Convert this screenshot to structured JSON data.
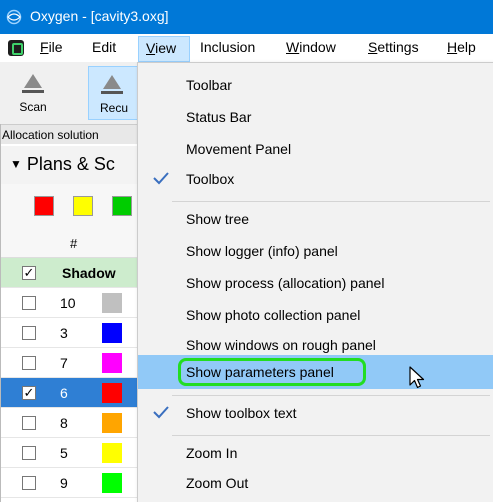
{
  "window": {
    "title": "Oxygen - [cavity3.oxg]"
  },
  "menubar": {
    "items": [
      {
        "label": "File",
        "u": "F",
        "rest": "ile"
      },
      {
        "label": "Edit"
      },
      {
        "label": "View",
        "u": "V",
        "rest": "iew"
      },
      {
        "label": "Inclusion"
      },
      {
        "label": "Window",
        "u": "W",
        "rest": "indow"
      },
      {
        "label": "Settings",
        "u": "S",
        "rest": "ettings"
      },
      {
        "label": "Help",
        "u": "H",
        "rest": "elp"
      }
    ]
  },
  "toolbar": {
    "scan_label": "Scan",
    "recu_label": "Recu"
  },
  "panel": {
    "allocation_label": "Allocation solution",
    "plans_label": "Plans & Sc",
    "column_hash": "#",
    "shadow_label": "Shadow",
    "rows": [
      {
        "num": "10",
        "color": "#c0c0c0",
        "checked": false
      },
      {
        "num": "3",
        "color": "#0000ff",
        "checked": false
      },
      {
        "num": "7",
        "color": "#ff00ff",
        "checked": false
      },
      {
        "num": "6",
        "color": "#ff0000",
        "checked": true
      },
      {
        "num": "8",
        "color": "#ffa500",
        "checked": false
      },
      {
        "num": "5",
        "color": "#ffff00",
        "checked": false
      },
      {
        "num": "9",
        "color": "#00ff00",
        "checked": false
      }
    ],
    "swatch_colors": [
      "#ff0000",
      "#ffff00",
      "#00cc00"
    ]
  },
  "view_menu": {
    "items": [
      {
        "label": "Toolbar",
        "checked": false
      },
      {
        "label": "Status Bar",
        "checked": false
      },
      {
        "label": "Movement Panel",
        "checked": false
      },
      {
        "label": "Toolbox",
        "checked": true
      },
      {
        "label": "Show tree",
        "checked": false
      },
      {
        "label": "Show logger (info) panel",
        "checked": false
      },
      {
        "label": "Show process (allocation) panel",
        "checked": false
      },
      {
        "label": "Show photo collection panel",
        "checked": false
      },
      {
        "label": "Show windows on rough panel",
        "checked": false
      },
      {
        "label": "Show parameters panel",
        "checked": false,
        "highlighted": true
      },
      {
        "label": "Show toolbox text",
        "checked": true
      },
      {
        "label": "Zoom In",
        "checked": false
      },
      {
        "label": "Zoom Out",
        "checked": false
      }
    ]
  },
  "colors": {
    "accent": "#0078d7",
    "highlight": "#91c9f7",
    "callout": "#22dd22"
  }
}
